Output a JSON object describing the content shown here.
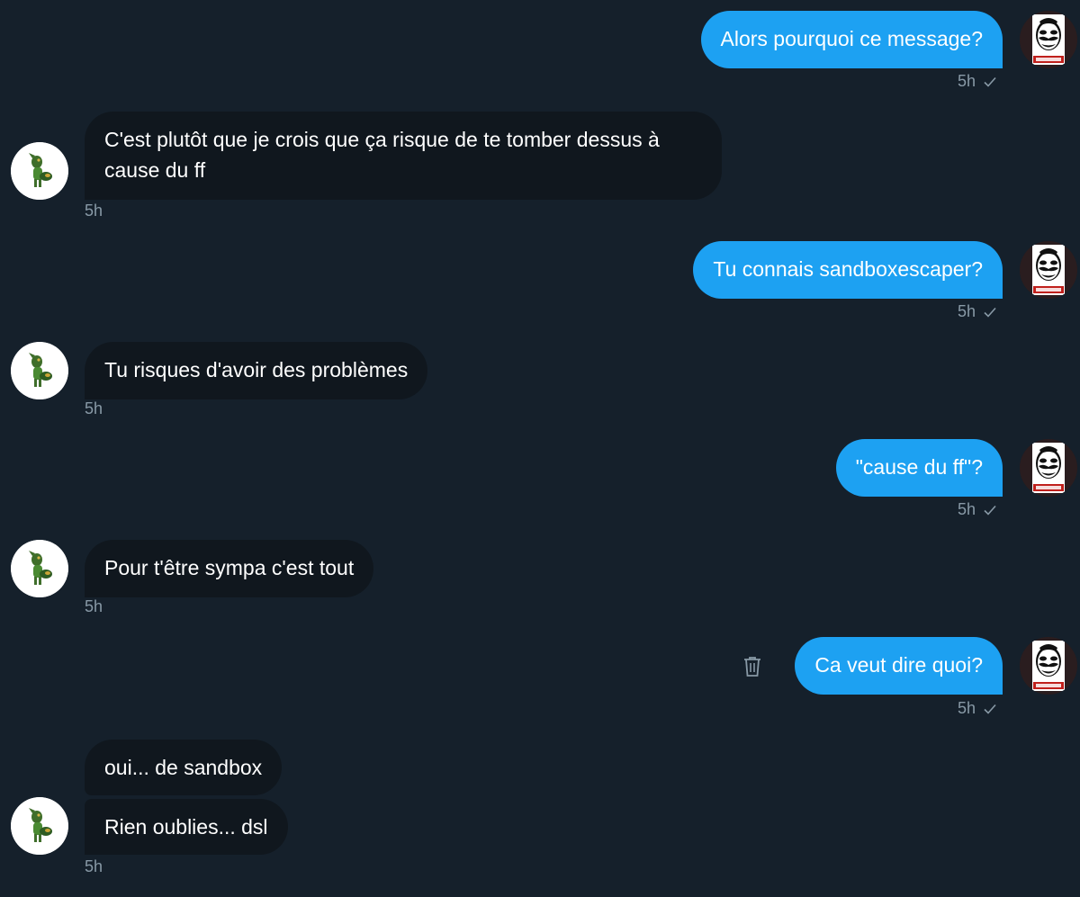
{
  "conversation": {
    "messages": [
      {
        "id": "m1",
        "side": "sent",
        "text": "Alors pourquoi ce message?",
        "time": "5h"
      },
      {
        "id": "m2",
        "side": "received",
        "text": "C'est plutôt que je crois que ça risque de te tomber dessus à cause du ff",
        "time": "5h"
      },
      {
        "id": "m3",
        "side": "sent",
        "text": "Tu connais sandboxescaper?",
        "time": "5h"
      },
      {
        "id": "m4",
        "side": "received",
        "text": "Tu risques d'avoir des problèmes",
        "time": "5h"
      },
      {
        "id": "m5",
        "side": "sent",
        "text": "\"cause du ff\"?",
        "time": "5h"
      },
      {
        "id": "m6",
        "side": "received",
        "text": "Pour t'être sympa c'est tout",
        "time": "5h"
      },
      {
        "id": "m7",
        "side": "sent",
        "text": "Ca veut dire quoi?",
        "time": "5h"
      },
      {
        "id": "m8",
        "side": "received",
        "text": "oui... de sandbox"
      },
      {
        "id": "m9",
        "side": "received",
        "text": "Rien oublies... dsl",
        "time": "5h"
      }
    ],
    "read_receipt_icon": "checkmark-icon",
    "delete_icon": "trash-icon",
    "my_avatar": {
      "icon": "fsociety-mask-avatar",
      "caption": "FSOCIETY"
    },
    "their_avatar": {
      "icon": "cartoon-character-avatar"
    }
  },
  "theme": {
    "background": "#15202b",
    "sent_bubble": "#1da1f2",
    "received_bubble": "#10171e",
    "meta_text": "#8899a6"
  }
}
